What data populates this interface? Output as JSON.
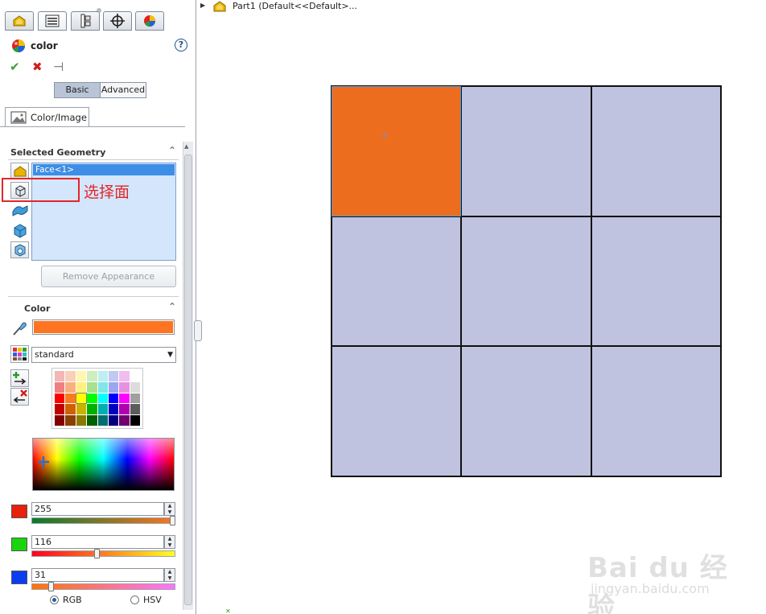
{
  "tabs": [
    {
      "icon": "part-feature-tree-icon"
    },
    {
      "icon": "property-manager-icon"
    },
    {
      "icon": "configuration-manager-icon"
    },
    {
      "icon": "dimxpert-icon"
    },
    {
      "icon": "display-manager-icon"
    }
  ],
  "property_manager": {
    "title": "color",
    "help": "?",
    "ok_icon": "✔",
    "cancel_icon": "✖",
    "pin_icon": "⊣"
  },
  "mode": {
    "basic": "Basic",
    "advanced": "Advanced",
    "active": "Basic"
  },
  "color_image_tab": {
    "label": "Color/Image"
  },
  "selected_geometry": {
    "header": "Selected Geometry",
    "items": [
      "Face<1>"
    ],
    "filters": [
      "select-parts-icon",
      "select-faces-icon",
      "select-surfaces-icon",
      "select-bodies-icon",
      "select-features-icon"
    ]
  },
  "annotation": {
    "text": "选择面"
  },
  "remove_button": {
    "label": "Remove Appearance"
  },
  "color_section": {
    "header": "Color",
    "current_color": "#ff7420",
    "palette": "standard",
    "rgb": {
      "r": "255",
      "g": "116",
      "b": "31"
    },
    "slider_levels": {
      "r": 1.0,
      "g": 0.455,
      "b": 0.12
    },
    "mode_rgb": "RGB",
    "mode_hsv": "HSV",
    "selected_mode": "RGB"
  },
  "swatches": [
    "#f4b6b6",
    "#f8d0b8",
    "#fff6b0",
    "#cfeec0",
    "#bdeff0",
    "#c0c8f4",
    "#f1bdee",
    "#ffffff",
    "#ef8080",
    "#f8b080",
    "#fff080",
    "#a8e090",
    "#80e6e6",
    "#9aa6f0",
    "#e890e0",
    "#dcdcdc",
    "#ff0000",
    "#f87c1e",
    "#ffff00",
    "#00ff00",
    "#00ffff",
    "#0000ff",
    "#ff00ff",
    "#a0a0a0",
    "#c00000",
    "#d06000",
    "#c8b400",
    "#00b000",
    "#00b0b0",
    "#0000c0",
    "#b000b0",
    "#5c5c5c",
    "#800000",
    "#8a4000",
    "#8a7a00",
    "#006000",
    "#006e6e",
    "#000080",
    "#700070",
    "#000000"
  ],
  "feature_tree": {
    "label": "Part1  (Default<<Default>..."
  },
  "watermark": {
    "brand": "Bai du 经验",
    "url": "jingyan.baidu.com"
  }
}
